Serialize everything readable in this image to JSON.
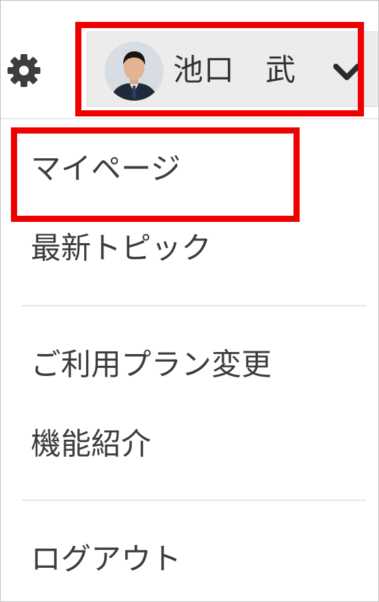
{
  "header": {
    "settings_icon": "gear-icon",
    "user": {
      "name": "池口　武",
      "avatar": "user-avatar",
      "dropdown_icon": "chevron-down-icon"
    }
  },
  "menu": {
    "items": [
      {
        "label": "マイページ"
      },
      {
        "label": "最新トピック"
      },
      {
        "label": "ご利用プラン変更"
      },
      {
        "label": "機能紹介"
      },
      {
        "label": "ログアウト"
      }
    ]
  },
  "highlight_color": "#ee0000"
}
